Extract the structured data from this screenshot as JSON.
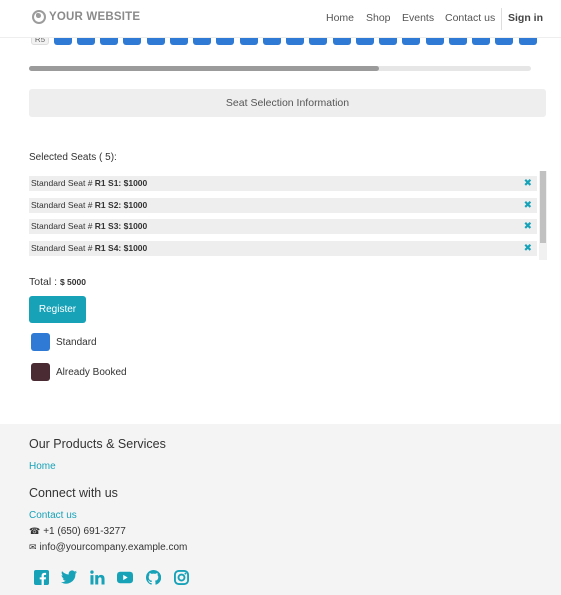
{
  "header": {
    "logo_text": "YOUR WEBSITE",
    "nav": [
      {
        "label": "Home"
      },
      {
        "label": "Shop"
      },
      {
        "label": "Events"
      },
      {
        "label": "Contact us"
      },
      {
        "label": "Sign in"
      }
    ]
  },
  "seat_map": {
    "row_label": "R5",
    "available_color": "#2f7ad4"
  },
  "info_button": {
    "label": "Seat Selection Information"
  },
  "selection": {
    "title": "Selected Seats ( 5):",
    "seats": [
      {
        "prefix": "Standard Seat # ",
        "detail": "R1 S1: $1000"
      },
      {
        "prefix": "Standard Seat # ",
        "detail": "R1 S2: $1000"
      },
      {
        "prefix": "Standard Seat # ",
        "detail": "R1 S3: $1000"
      },
      {
        "prefix": "Standard Seat # ",
        "detail": "R1 S4: $1000"
      }
    ],
    "total_label": "Total :",
    "total_value": "$ 5000",
    "register_label": "Register"
  },
  "legend": [
    {
      "label": "Standard",
      "color": "#2f7ad4"
    },
    {
      "label": "Already Booked",
      "color": "#4a2a33"
    }
  ],
  "footer": {
    "products_title": "Our Products & Services",
    "home_link": "Home",
    "connect_title": "Connect with us",
    "contact_link": "Contact us",
    "phone": "+1 (650) 691-3277",
    "email": "info@yourcompany.example.com"
  },
  "colors": {
    "accent": "#17a2b8",
    "seat": "#2f7ad4",
    "booked": "#4a2a33"
  }
}
